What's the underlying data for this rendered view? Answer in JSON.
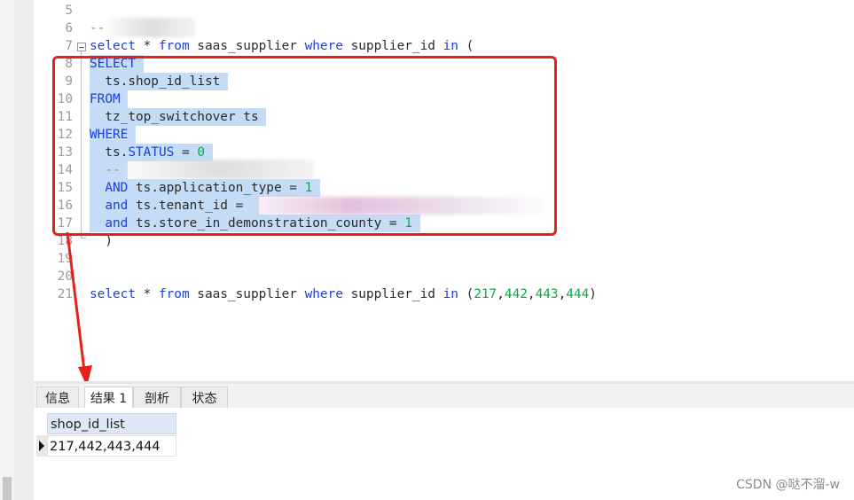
{
  "editor": {
    "lines": [
      {
        "n": "5",
        "parts": [],
        "sel": false
      },
      {
        "n": "6",
        "parts": [
          {
            "t": "--",
            "c": "cm"
          }
        ],
        "sel": false
      },
      {
        "n": "7",
        "parts": [
          {
            "t": "select",
            "c": "kw"
          },
          {
            "t": " * ",
            "c": ""
          },
          {
            "t": "from",
            "c": "kw"
          },
          {
            "t": " saas_supplier ",
            "c": ""
          },
          {
            "t": "where",
            "c": "kw"
          },
          {
            "t": " supplier_id ",
            "c": ""
          },
          {
            "t": "in",
            "c": "kw"
          },
          {
            "t": " (",
            "c": ""
          }
        ],
        "sel": false
      },
      {
        "n": "8",
        "parts": [
          {
            "t": "SELECT",
            "c": "kw"
          }
        ],
        "sel": true
      },
      {
        "n": "9",
        "parts": [
          {
            "t": "  ts.shop_id_list",
            "c": ""
          }
        ],
        "sel": true
      },
      {
        "n": "10",
        "parts": [
          {
            "t": "FROM",
            "c": "kw"
          }
        ],
        "sel": true
      },
      {
        "n": "11",
        "parts": [
          {
            "t": "  tz_top_switchover ts",
            "c": ""
          }
        ],
        "sel": true
      },
      {
        "n": "12",
        "parts": [
          {
            "t": "WHERE",
            "c": "kw"
          }
        ],
        "sel": true
      },
      {
        "n": "13",
        "parts": [
          {
            "t": "  ts.",
            "c": ""
          },
          {
            "t": "STATUS",
            "c": "kw"
          },
          {
            "t": " = ",
            "c": ""
          },
          {
            "t": "0",
            "c": "num"
          }
        ],
        "sel": true
      },
      {
        "n": "14",
        "parts": [
          {
            "t": "  --",
            "c": "cm"
          }
        ],
        "sel": true
      },
      {
        "n": "15",
        "parts": [
          {
            "t": "  ",
            "c": ""
          },
          {
            "t": "AND",
            "c": "kw"
          },
          {
            "t": " ts.application_type = ",
            "c": ""
          },
          {
            "t": "1",
            "c": "num"
          }
        ],
        "sel": true
      },
      {
        "n": "16",
        "parts": [
          {
            "t": "  ",
            "c": ""
          },
          {
            "t": "and",
            "c": "kw"
          },
          {
            "t": " ts.tenant_id = ",
            "c": ""
          }
        ],
        "sel": true
      },
      {
        "n": "17",
        "parts": [
          {
            "t": "  ",
            "c": ""
          },
          {
            "t": "and",
            "c": "kw"
          },
          {
            "t": " ts.store_in_demonstration_county = ",
            "c": ""
          },
          {
            "t": "1",
            "c": "num"
          }
        ],
        "sel": true
      },
      {
        "n": "18",
        "parts": [
          {
            "t": "  )",
            "c": ""
          }
        ],
        "sel": false
      },
      {
        "n": "19",
        "parts": [],
        "sel": false
      },
      {
        "n": "20",
        "parts": [],
        "sel": false
      },
      {
        "n": "21",
        "parts": [
          {
            "t": "select",
            "c": "kw"
          },
          {
            "t": " * ",
            "c": ""
          },
          {
            "t": "from",
            "c": "kw"
          },
          {
            "t": " saas_supplier ",
            "c": ""
          },
          {
            "t": "where",
            "c": "kw"
          },
          {
            "t": " supplier_id ",
            "c": ""
          },
          {
            "t": "in",
            "c": "kw"
          },
          {
            "t": " (",
            "c": ""
          },
          {
            "t": "217",
            "c": "num"
          },
          {
            "t": ",",
            "c": ""
          },
          {
            "t": "442",
            "c": "num"
          },
          {
            "t": ",",
            "c": ""
          },
          {
            "t": "443",
            "c": "num"
          },
          {
            "t": ",",
            "c": ""
          },
          {
            "t": "444",
            "c": "num"
          },
          {
            "t": ")",
            "c": ""
          }
        ],
        "sel": false
      }
    ]
  },
  "tabs": [
    {
      "label": "信息"
    },
    {
      "label": "结果 1"
    },
    {
      "label": "剖析"
    },
    {
      "label": "状态"
    }
  ],
  "results": {
    "column": "shop_id_list",
    "value": "217,442,443,444"
  },
  "watermark": "CSDN @哒不溜-w",
  "colors": {
    "selection": "#c5dcf7",
    "keyword": "#1d3fd6",
    "number": "#12a34a",
    "annotation": "#e8201c"
  }
}
